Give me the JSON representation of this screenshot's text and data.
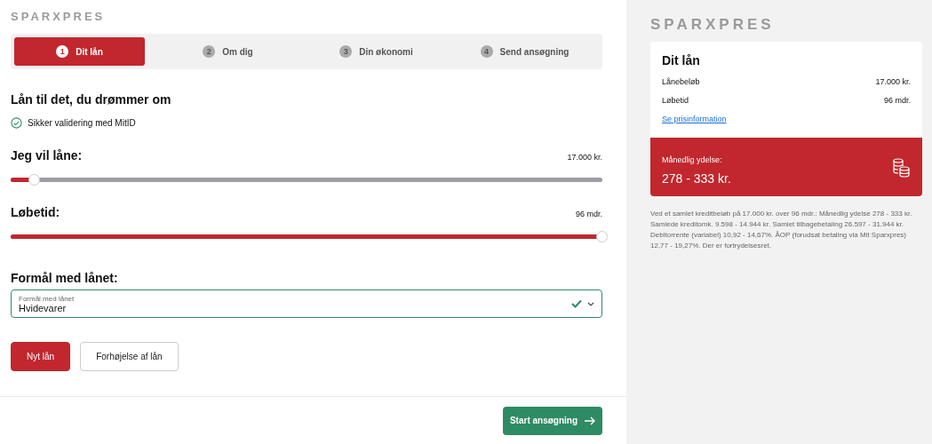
{
  "logo": "SPARXPRES",
  "steps": [
    {
      "number": "1",
      "label": "Dit lån",
      "selected": true
    },
    {
      "number": "2",
      "label": "Om dig",
      "selected": false
    },
    {
      "number": "3",
      "label": "Din økonomi",
      "selected": false
    },
    {
      "number": "4",
      "label": "Send ansøgning",
      "selected": false
    }
  ],
  "heading": "Lån til det, du drømmer om",
  "validation": "Sikker validering med MitID",
  "sliders": [
    {
      "label": "Jeg vil låne:",
      "reading": "17.000 kr.",
      "level": 0.04
    },
    {
      "label": "Løbetid:",
      "reading": "96 mdr.",
      "level": 1
    }
  ],
  "purpose": {
    "label": "Formål med lånet:",
    "field_label": "Formål med lånet",
    "value": "Hvidevarer",
    "valid": true
  },
  "loan_types": [
    {
      "label": "Nyt lån",
      "selected": true
    },
    {
      "label": "Forhøjelse af lån",
      "selected": false
    }
  ],
  "submit": "Start ansøgning",
  "summary": {
    "logo": "SPARXPRES",
    "title": "Dit lån",
    "rows": [
      {
        "label": "Lånebeløb",
        "value": "17.000 kr."
      },
      {
        "label": "Løbetid",
        "value": "96 mdr."
      }
    ],
    "link": "Se prisinformation",
    "monthly_label": "Månedlig ydelse:",
    "monthly_value": "278 - 333 kr."
  },
  "disclaimer": "Ved et samlet kreditbeløb på 17.000 kr. over 96 mdr.: Månedlig ydelse 278 - 333 kr. Samlede kreditomk. 9.598 - 14.944 kr. Samlet tilbagebetaling 26.597 - 31.944 kr. Debitorrente (variabel) 10,92 - 14,67%. ÅOP (forudsat betaling via Mit Sparxpres) 12,77 - 19,27%. Der er fortrydelsesret."
}
